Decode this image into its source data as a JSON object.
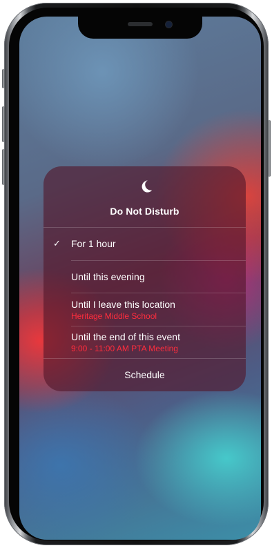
{
  "do_not_disturb": {
    "icon": "moon-icon",
    "title": "Do Not Disturb",
    "options": [
      {
        "label": "For 1 hour",
        "selected": true
      },
      {
        "label": "Until this evening",
        "selected": false
      },
      {
        "label": "Until I leave this location",
        "sublabel": "Heritage Middle School",
        "selected": false
      },
      {
        "label": "Until the end of this event",
        "sublabel": "9:00 - 11:00 AM PTA Meeting",
        "selected": false
      }
    ],
    "schedule_label": "Schedule",
    "check_glyph": "✓"
  },
  "colors": {
    "sublabel": "#ff2d3d",
    "panel": "#52162a"
  }
}
